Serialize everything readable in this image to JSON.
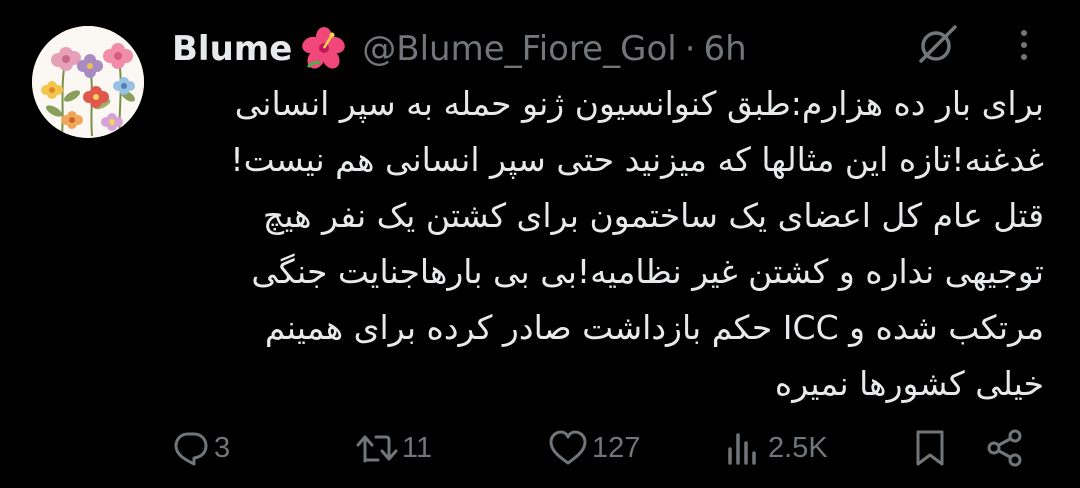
{
  "tweet": {
    "display_name": "Blume",
    "name_emoji": "hibiscus-emoji",
    "handle": "@Blume_Fiore_Gol",
    "separator": "·",
    "timestamp": "6h",
    "text_lines": [
      "برای بار ده هزارم:طبق کنوانسیون ژنو حمله به سپر انسانی",
      "غدغنه!تازه این مثالها که میزنید حتی سپر انسانی هم نیست!",
      "قتل عام کل اعضای یک ساختمون برای کشتن یک نفر هیچ",
      "توجیهی نداره و کشتن غیر نظامیه!بی بی بارهاجنایت جنگی",
      "مرتکب شده و ICC حکم بازداشت صادر کرده برای همینم",
      "خیلی کشورها نمیره"
    ]
  },
  "actions": {
    "replies": "3",
    "retweets": "11",
    "likes": "127",
    "views": "2.5K"
  },
  "icons": {
    "top": [
      "grok-icon",
      "more-options-icon"
    ],
    "actions": [
      "reply-icon",
      "retweet-icon",
      "like-icon",
      "views-icon",
      "bookmark-icon",
      "share-icon"
    ]
  },
  "colors": {
    "background": "#000000",
    "primary_text": "#e7e9ea",
    "secondary_text": "#71767b"
  }
}
